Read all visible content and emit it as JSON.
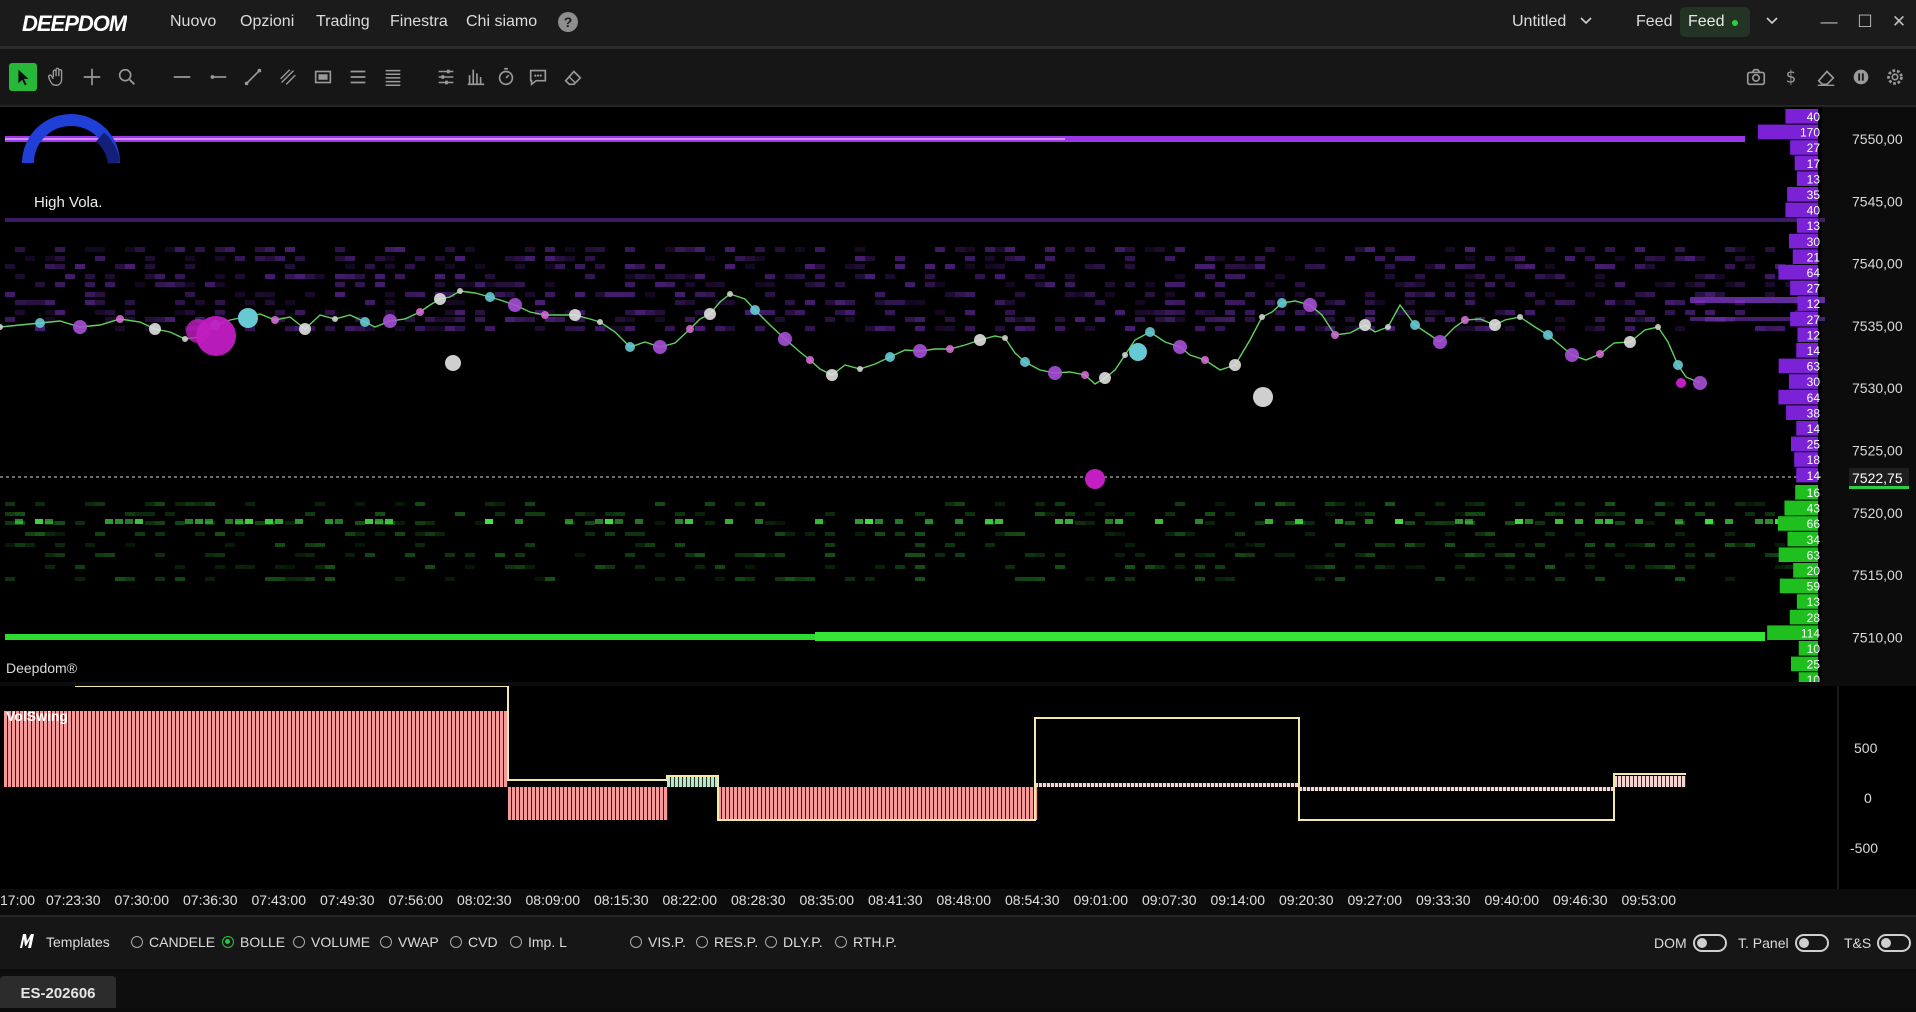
{
  "app": {
    "brand": "DEEPDOM"
  },
  "menu": [
    "Nuovo",
    "Opzioni",
    "Trading",
    "Finestra",
    "Chi siamo"
  ],
  "topbar_right": {
    "workspace": "Untitled",
    "feed_label": "Feed",
    "feed_status": "Feed"
  },
  "window_controls": {
    "minimize": "—",
    "maximize": "☐",
    "close": "✕"
  },
  "toolbar": {
    "left_tools": [
      "pointer-icon",
      "hand-icon",
      "crosshair-icon",
      "zoom-icon",
      "hline-icon",
      "ray-icon",
      "trendline-icon",
      "channel-icon",
      "rectangle-icon",
      "list-icon",
      "levels-icon",
      "settings-sliders-icon",
      "volume-bars-icon",
      "timer-icon",
      "comment-icon",
      "eraser-icon"
    ],
    "right_tools": [
      "camera-icon",
      "dollar-icon",
      "clear-icon",
      "pause-icon",
      "gear-icon"
    ]
  },
  "main_chart": {
    "watermark": "Deepdom®",
    "volatility_label": "High Vola.",
    "last_price": "7522,75",
    "price_labels": [
      "7550,00",
      "7545,00",
      "7540,00",
      "7535,00",
      "7530,00",
      "7525,00",
      "7520,00",
      "7515,00",
      "7510,00"
    ],
    "ask_volumes": [
      "40",
      "170",
      "27",
      "17",
      "13",
      "35",
      "40",
      "13",
      "30",
      "21",
      "64",
      "27",
      "12",
      "27",
      "12",
      "14",
      "63",
      "30",
      "64",
      "38",
      "14",
      "25",
      "18",
      "14"
    ],
    "bid_volumes": [
      "16",
      "43",
      "66",
      "34",
      "63",
      "20",
      "59",
      "13",
      "28",
      "114",
      "10",
      "25",
      "10"
    ]
  },
  "sub_chart": {
    "title": "VolSwing",
    "y_labels": [
      "500",
      "0",
      "-500"
    ]
  },
  "time_axis": [
    "17:00",
    "07:23:30",
    "07:30:00",
    "07:36:30",
    "07:43:00",
    "07:49:30",
    "07:56:00",
    "08:02:30",
    "08:09:00",
    "08:15:30",
    "08:22:00",
    "08:28:30",
    "08:35:00",
    "08:41:30",
    "08:48:00",
    "08:54:30",
    "09:01:00",
    "09:07:30",
    "09:14:00",
    "09:20:30",
    "09:27:00",
    "09:33:30",
    "09:40:00",
    "09:46:30",
    "09:53:00"
  ],
  "bottom_bar": {
    "templates_label": "Templates",
    "chart_types": [
      "CANDELE",
      "BOLLE",
      "VOLUME",
      "VWAP",
      "CVD",
      "Imp. L"
    ],
    "selected_chart_type": "BOLLE",
    "profiles": [
      "VIS.P.",
      "RES.P.",
      "DLY.P.",
      "RTH.P."
    ],
    "toggles": [
      "DOM",
      "T. Panel",
      "T&S"
    ]
  },
  "tabs": [
    "ES-202606"
  ],
  "colors": {
    "accent_green": "#27b83a",
    "ask_purple": "#8a2be2",
    "bid_green": "#22cc22",
    "price_line": "#5fd35f"
  }
}
